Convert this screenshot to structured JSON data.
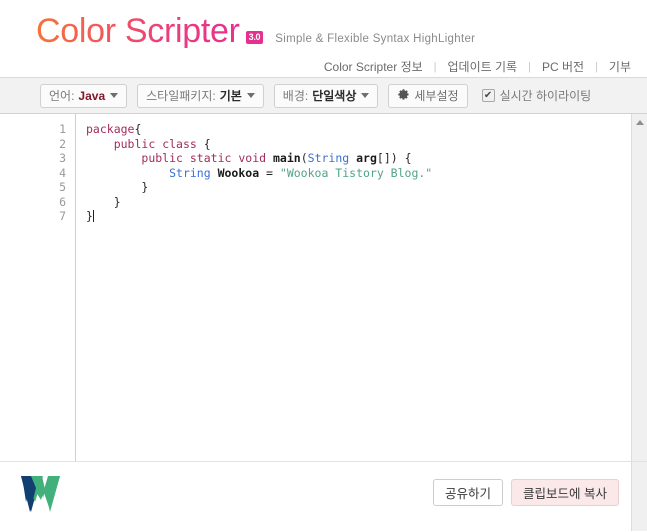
{
  "header": {
    "logo_text": "Color Scripter",
    "version_badge": "3.0",
    "tagline": "Simple & Flexible Syntax HighLighter",
    "nav_links": [
      {
        "label": "Color Scripter 정보"
      },
      {
        "label": "업데이트 기록"
      },
      {
        "label": "PC 버전"
      },
      {
        "label": "기부"
      }
    ],
    "nav_separator": "|"
  },
  "toolbar": {
    "language": {
      "label": "언어:",
      "value": "Java",
      "icon": "chevron-down-icon"
    },
    "style_package": {
      "label": "스타일패키지:",
      "value": "기본",
      "icon": "chevron-down-icon"
    },
    "background": {
      "label": "배경:",
      "value": "단일색상",
      "icon": "chevron-down-icon"
    },
    "details_button": {
      "label": "세부설정",
      "icon": "gear-icon"
    },
    "realtime_highlight": {
      "label": "실시간 하이라이팅",
      "checked": true,
      "check_glyph": "✔"
    }
  },
  "editor": {
    "line_numbers": [
      "1",
      "2",
      "3",
      "4",
      "5",
      "6",
      "7"
    ],
    "lines": [
      {
        "n": 1,
        "tokens": [
          {
            "t": "kw",
            "v": "package"
          },
          {
            "t": "pl",
            "v": "{"
          }
        ]
      },
      {
        "n": 2,
        "tokens": [
          {
            "t": "pl",
            "v": "    "
          },
          {
            "t": "kw",
            "v": "public"
          },
          {
            "t": "pl",
            "v": " "
          },
          {
            "t": "kw",
            "v": "class"
          },
          {
            "t": "pl",
            "v": " {"
          }
        ]
      },
      {
        "n": 3,
        "tokens": [
          {
            "t": "pl",
            "v": "        "
          },
          {
            "t": "kw",
            "v": "public"
          },
          {
            "t": "pl",
            "v": " "
          },
          {
            "t": "kw",
            "v": "static"
          },
          {
            "t": "pl",
            "v": " "
          },
          {
            "t": "kw",
            "v": "void"
          },
          {
            "t": "pl",
            "v": " "
          },
          {
            "t": "fn",
            "v": "main"
          },
          {
            "t": "pl",
            "v": "("
          },
          {
            "t": "type",
            "v": "String"
          },
          {
            "t": "pl",
            "v": " "
          },
          {
            "t": "fn",
            "v": "arg"
          },
          {
            "t": "pl",
            "v": "[]) {"
          }
        ]
      },
      {
        "n": 4,
        "tokens": [
          {
            "t": "pl",
            "v": "            "
          },
          {
            "t": "type",
            "v": "String"
          },
          {
            "t": "pl",
            "v": " "
          },
          {
            "t": "fn",
            "v": "Wookoa"
          },
          {
            "t": "pl",
            "v": " = "
          },
          {
            "t": "str",
            "v": "\"Wookoa Tistory Blog.\""
          }
        ]
      },
      {
        "n": 5,
        "tokens": [
          {
            "t": "pl",
            "v": "        }"
          }
        ]
      },
      {
        "n": 6,
        "tokens": [
          {
            "t": "pl",
            "v": "    }"
          }
        ]
      },
      {
        "n": 7,
        "tokens": [
          {
            "t": "pl",
            "v": "}"
          }
        ],
        "cursor": true
      }
    ],
    "plain_text": "package{\n    public class {\n        public static void main(String arg[]) {\n            String Wookoa = \"Wookoa Tistory Blog.\"\n        }\n    }\n}"
  },
  "scrollbar": {
    "up_arrow_icon": "triangle-up-icon"
  },
  "footer": {
    "brand_logo": "w-logo",
    "share_button": "공유하기",
    "copy_button": "클립보드에 복사"
  },
  "colors": {
    "logo_gradient_start": "#f4743b",
    "logo_gradient_end": "#e5308f",
    "badge_bg": "#e5308f",
    "toolbar_bg": "#f2f2f2",
    "value_accent": "#7d1728",
    "keyword": "#a32c5e",
    "type": "#3a6fd8",
    "string": "#4fa38a",
    "copy_button_bg": "#fbe9ea",
    "logo_navy": "#113f72",
    "logo_green": "#42b07a"
  }
}
